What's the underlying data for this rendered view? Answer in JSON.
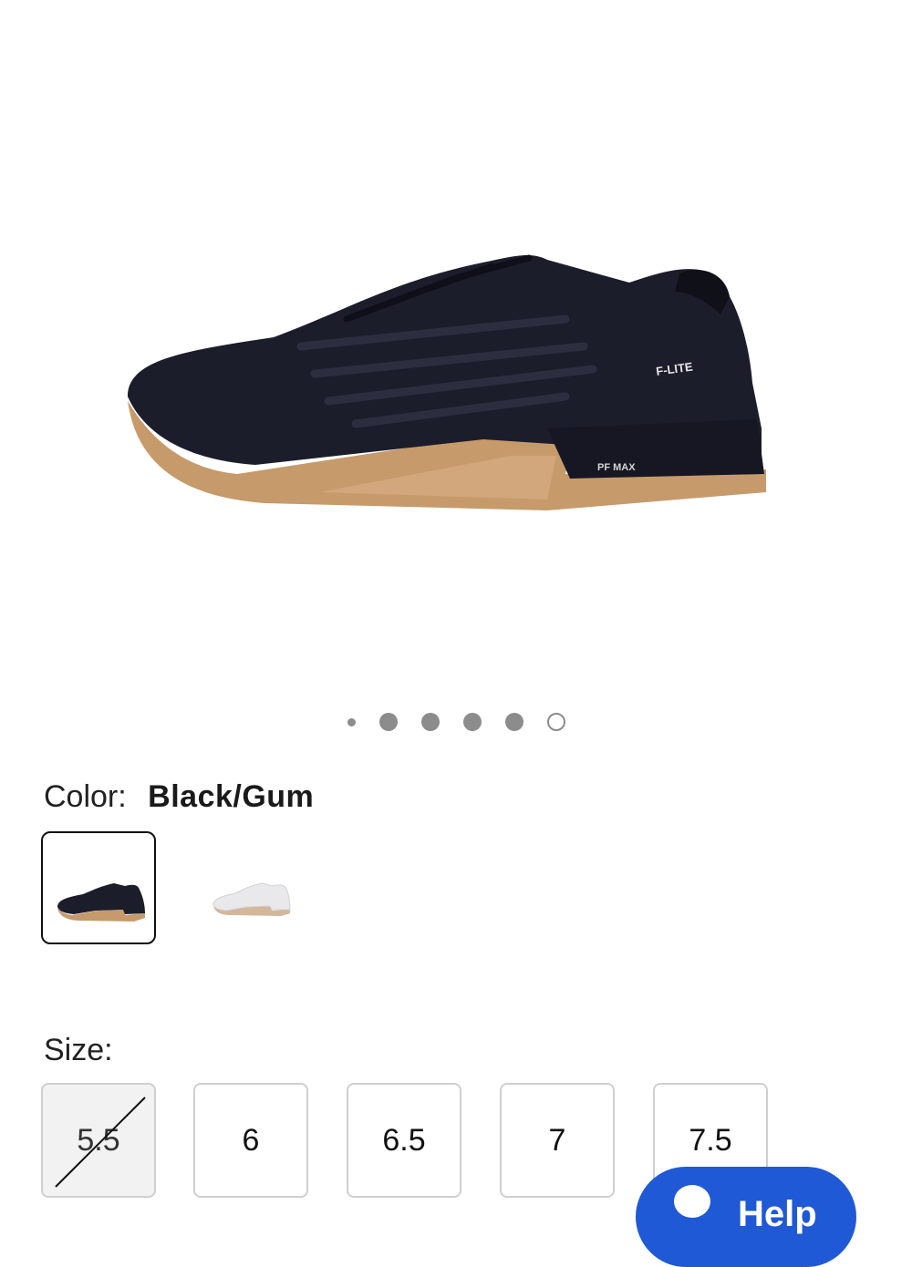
{
  "gallery": {
    "image_name": "product-shoe-image",
    "shoe_logo_text": "F-LITE",
    "sole_text": "PF MAX",
    "total_slides": 6,
    "active_slide": 6
  },
  "color": {
    "label": "Color:",
    "value": "Black/Gum",
    "swatches": [
      {
        "name": "Black/Gum",
        "selected": true
      },
      {
        "name": "White",
        "selected": false
      }
    ]
  },
  "size": {
    "label": "Size:",
    "options": [
      {
        "label": "5.5",
        "available": false
      },
      {
        "label": "6",
        "available": true
      },
      {
        "label": "6.5",
        "available": true
      },
      {
        "label": "7",
        "available": true
      },
      {
        "label": "7.5",
        "available": true
      }
    ]
  },
  "help": {
    "label": "Help",
    "icon": "chat-icon",
    "color": "#1f59d6"
  }
}
